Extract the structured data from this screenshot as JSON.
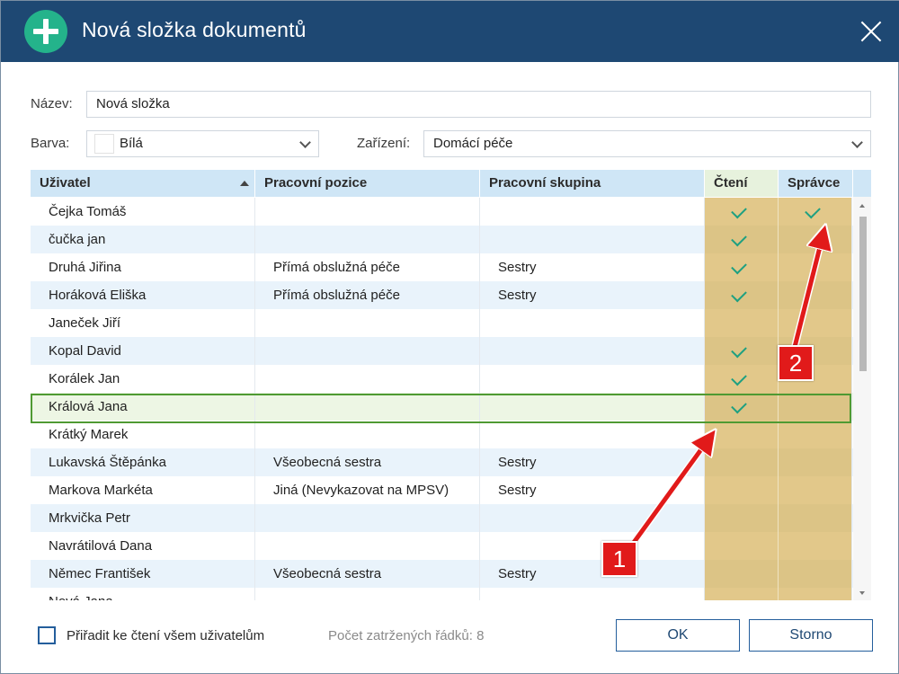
{
  "window": {
    "title": "Nová složka dokumentů",
    "close_icon": "close-icon",
    "add_icon": "plus-circle-icon"
  },
  "form": {
    "name_label": "Název:",
    "name_value": "Nová složka",
    "color_label": "Barva:",
    "color_value": "Bílá",
    "device_label": "Zařízení:",
    "device_value": "Domácí péče"
  },
  "grid": {
    "columns": {
      "user": "Uživatel",
      "position": "Pracovní pozice",
      "group": "Pracovní skupina",
      "read": "Čtení",
      "admin": "Správce"
    },
    "sort": {
      "column": "user",
      "direction": "ascending"
    },
    "rows": [
      {
        "user": "Čejka Tomáš",
        "position": "",
        "group": "",
        "read": true,
        "admin": true
      },
      {
        "user": "čučka jan",
        "position": "",
        "group": "",
        "read": true,
        "admin": false
      },
      {
        "user": "Druhá Jiřina",
        "position": "Přímá obslužná péče",
        "group": "Sestry",
        "read": true,
        "admin": false
      },
      {
        "user": "Horáková Eliška",
        "position": "Přímá obslužná péče",
        "group": "Sestry",
        "read": true,
        "admin": false
      },
      {
        "user": "Janeček Jiří",
        "position": "",
        "group": "",
        "read": false,
        "admin": false
      },
      {
        "user": "Kopal David",
        "position": "",
        "group": "",
        "read": true,
        "admin": false
      },
      {
        "user": "Korálek Jan",
        "position": "",
        "group": "",
        "read": true,
        "admin": false
      },
      {
        "user": "Králová Jana",
        "position": "",
        "group": "",
        "read": true,
        "admin": false,
        "selected": true
      },
      {
        "user": "Krátký Marek",
        "position": "",
        "group": "",
        "read": false,
        "admin": false
      },
      {
        "user": "Lukavská Štěpánka",
        "position": "Všeobecná sestra",
        "group": "Sestry",
        "read": false,
        "admin": false
      },
      {
        "user": "Markova Markéta",
        "position": "Jiná (Nevykazovat na MPSV)",
        "group": "Sestry",
        "read": false,
        "admin": false
      },
      {
        "user": "Mrkvička Petr",
        "position": "",
        "group": "",
        "read": false,
        "admin": false
      },
      {
        "user": "Navrátilová Dana",
        "position": "",
        "group": "",
        "read": false,
        "admin": false
      },
      {
        "user": "Němec František",
        "position": "Všeobecná sestra",
        "group": "Sestry",
        "read": false,
        "admin": false
      },
      {
        "user": "Nová Jana",
        "position": "",
        "group": "",
        "read": false,
        "admin": false
      }
    ]
  },
  "footer": {
    "assign_all_label": "Přiřadit ke čtení všem uživatelům",
    "checked_count": "Počet zatržených řádků: 8",
    "ok_label": "OK",
    "cancel_label": "Storno"
  },
  "annotations": {
    "badge1": "1",
    "badge2": "2"
  },
  "colors": {
    "titlebar": "#1e4873",
    "accent_green": "#24b38b",
    "header_blue": "#cfe6f6",
    "permission_column": "#e2c88a",
    "selection_border": "#4f9a32",
    "annotation_red": "#e11a1a"
  }
}
